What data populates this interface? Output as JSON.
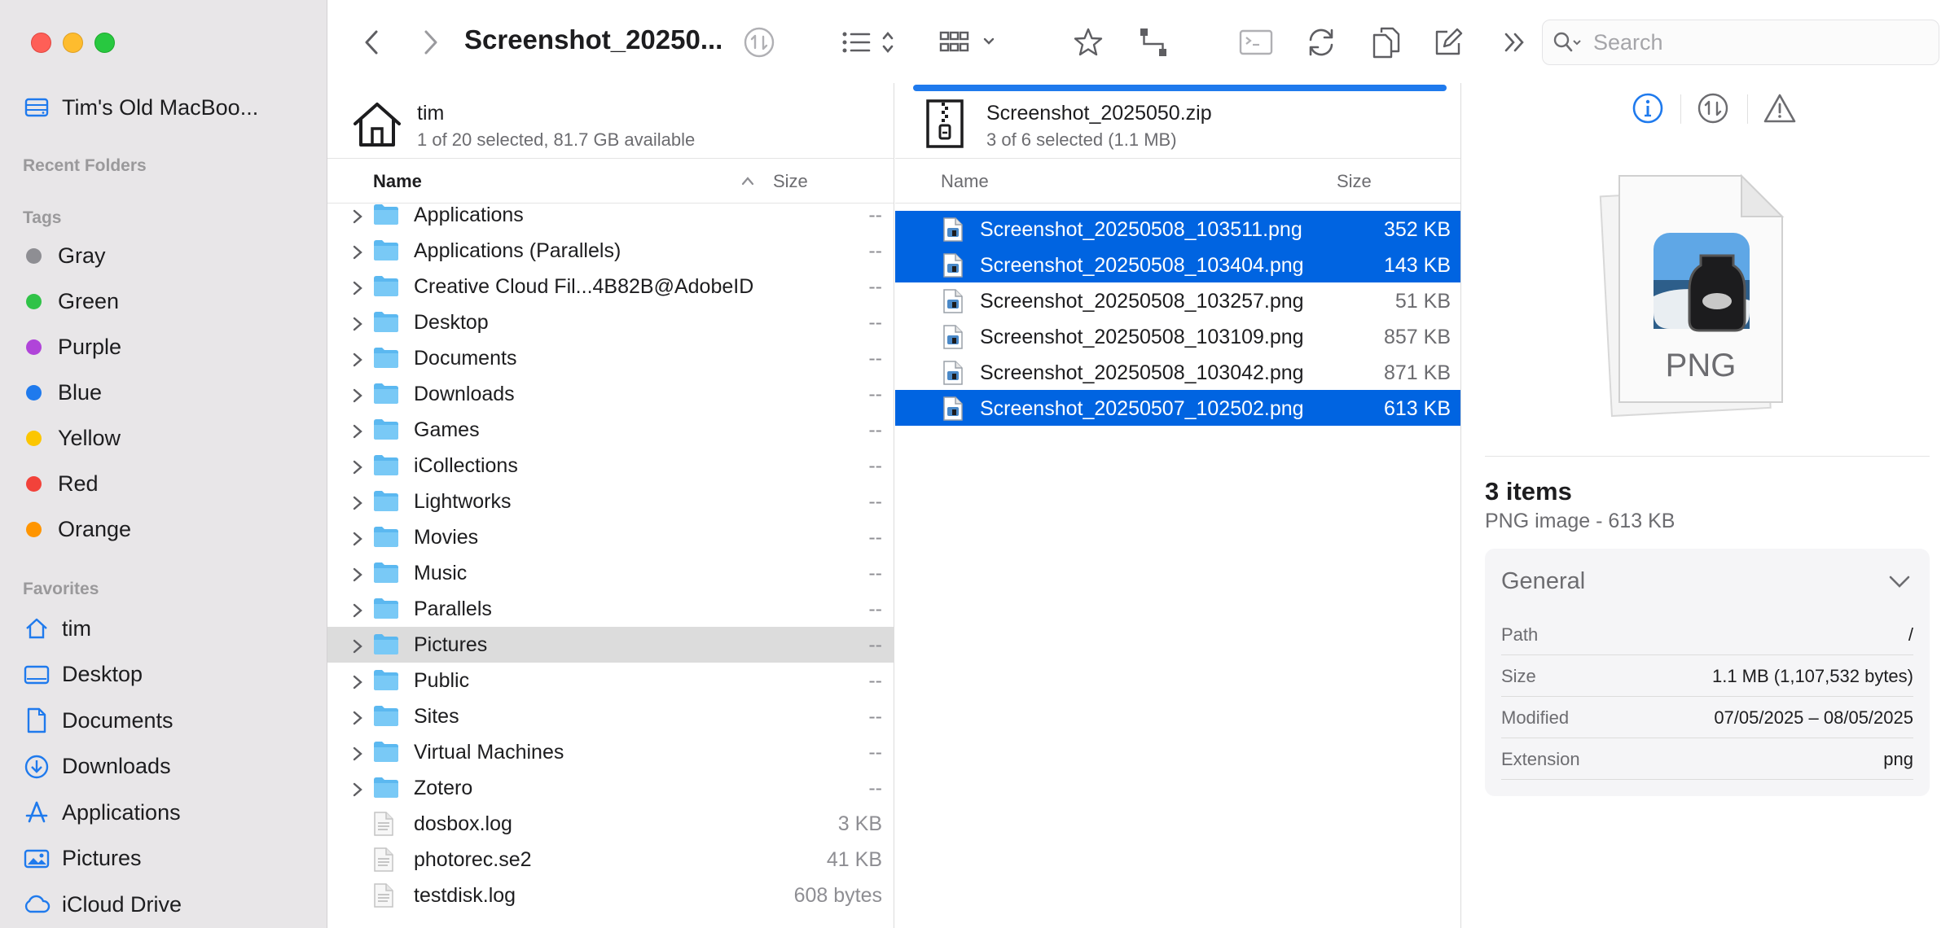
{
  "colors": {
    "accent": "#1f7aed",
    "selection": "#0064e1",
    "sidebar_bg": "#e8e6e8"
  },
  "sidebar": {
    "device": {
      "label": "Tim's Old MacBoo...",
      "icon": "drive-icon"
    },
    "recent_folders_header": "Recent Folders",
    "tags_header": "Tags",
    "tags": [
      {
        "label": "Gray",
        "color": "#8e8e93"
      },
      {
        "label": "Green",
        "color": "#30c348"
      },
      {
        "label": "Purple",
        "color": "#b044d9"
      },
      {
        "label": "Blue",
        "color": "#1f7aed"
      },
      {
        "label": "Yellow",
        "color": "#fcc600"
      },
      {
        "label": "Red",
        "color": "#f2423a"
      },
      {
        "label": "Orange",
        "color": "#ff9500"
      }
    ],
    "favorites_header": "Favorites",
    "favorites": [
      {
        "label": "tim",
        "icon": "home-icon"
      },
      {
        "label": "Desktop",
        "icon": "desktop-icon"
      },
      {
        "label": "Documents",
        "icon": "document-icon"
      },
      {
        "label": "Downloads",
        "icon": "download-icon"
      },
      {
        "label": "Applications",
        "icon": "applications-icon"
      },
      {
        "label": "Pictures",
        "icon": "pictures-icon"
      },
      {
        "label": "iCloud Drive",
        "icon": "cloud-icon"
      }
    ]
  },
  "toolbar": {
    "title": "Screenshot_20250...",
    "search_placeholder": "Search"
  },
  "left_pane": {
    "folder_name": "tim",
    "status": "1 of 20 selected, 81.7 GB available",
    "col_name": "Name",
    "col_size": "Size",
    "items": [
      {
        "name": "Applications",
        "size": "--",
        "type": "folder",
        "expandable": true
      },
      {
        "name": "Applications (Parallels)",
        "size": "--",
        "type": "folder",
        "expandable": true
      },
      {
        "name": "Creative Cloud Fil...4B82B@AdobeID",
        "size": "--",
        "type": "folder",
        "expandable": true
      },
      {
        "name": "Desktop",
        "size": "--",
        "type": "folder",
        "expandable": true
      },
      {
        "name": "Documents",
        "size": "--",
        "type": "folder",
        "expandable": true
      },
      {
        "name": "Downloads",
        "size": "--",
        "type": "folder",
        "expandable": true
      },
      {
        "name": "Games",
        "size": "--",
        "type": "folder",
        "expandable": true
      },
      {
        "name": "iCollections",
        "size": "--",
        "type": "folder",
        "expandable": true
      },
      {
        "name": "Lightworks",
        "size": "--",
        "type": "folder",
        "expandable": true
      },
      {
        "name": "Movies",
        "size": "--",
        "type": "folder",
        "expandable": true
      },
      {
        "name": "Music",
        "size": "--",
        "type": "folder",
        "expandable": true
      },
      {
        "name": "Parallels",
        "size": "--",
        "type": "folder",
        "expandable": true
      },
      {
        "name": "Pictures",
        "size": "--",
        "type": "folder",
        "expandable": true,
        "highlighted": true
      },
      {
        "name": "Public",
        "size": "--",
        "type": "folder",
        "expandable": true
      },
      {
        "name": "Sites",
        "size": "--",
        "type": "folder",
        "expandable": true
      },
      {
        "name": "Virtual Machines",
        "size": "--",
        "type": "folder",
        "expandable": true
      },
      {
        "name": "Zotero",
        "size": "--",
        "type": "folder",
        "expandable": true
      },
      {
        "name": "dosbox.log",
        "size": "3 KB",
        "type": "file",
        "expandable": false
      },
      {
        "name": "photorec.se2",
        "size": "41 KB",
        "type": "file",
        "expandable": false
      },
      {
        "name": "testdisk.log",
        "size": "608 bytes",
        "type": "file",
        "expandable": false
      }
    ]
  },
  "mid_pane": {
    "archive_name": "Screenshot_2025050.zip",
    "status": "3 of 6 selected (1.1 MB)",
    "progress": 1.0,
    "col_name": "Name",
    "col_size": "Size",
    "items": [
      {
        "name": "Screenshot_20250508_103511.png",
        "size": "352 KB",
        "selected": true
      },
      {
        "name": "Screenshot_20250508_103404.png",
        "size": "143 KB",
        "selected": true
      },
      {
        "name": "Screenshot_20250508_103257.png",
        "size": "51 KB",
        "selected": false
      },
      {
        "name": "Screenshot_20250508_103109.png",
        "size": "857 KB",
        "selected": false
      },
      {
        "name": "Screenshot_20250508_103042.png",
        "size": "871 KB",
        "selected": false
      },
      {
        "name": "Screenshot_20250507_102502.png",
        "size": "613 KB",
        "selected": true
      }
    ]
  },
  "info_pane": {
    "preview_label": "PNG",
    "count": "3 items",
    "kind": "PNG image - 613 KB",
    "general_title": "General",
    "rows": [
      {
        "key": "Path",
        "value": "/"
      },
      {
        "key": "Size",
        "value": "1.1 MB (1,107,532 bytes)"
      },
      {
        "key": "Modified",
        "value": "07/05/2025 – 08/05/2025"
      },
      {
        "key": "Extension",
        "value": "png"
      }
    ]
  }
}
